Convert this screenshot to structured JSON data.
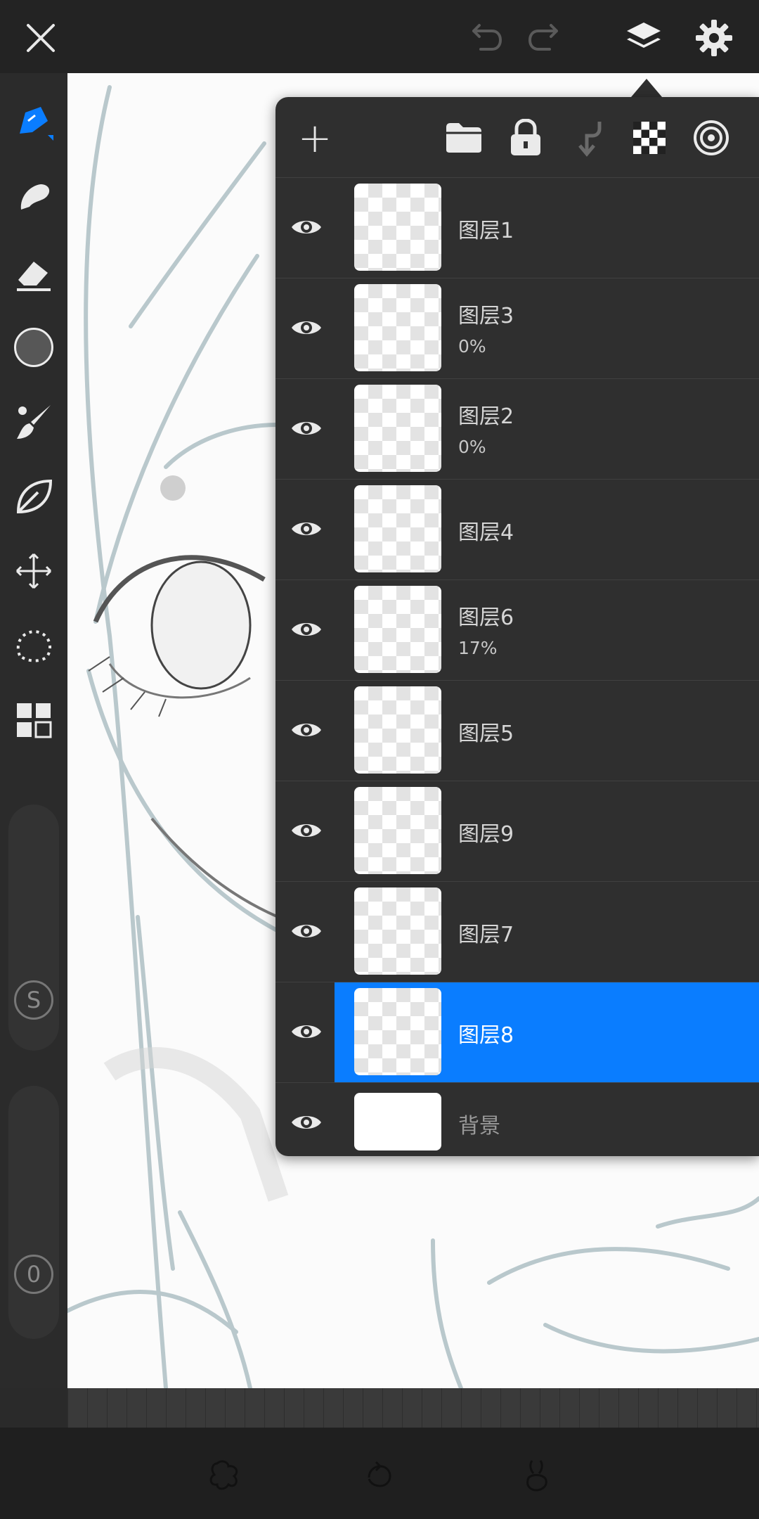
{
  "toolbar": {
    "close_icon": "close-icon",
    "undo_icon": "undo-icon",
    "redo_icon": "redo-icon",
    "layers_icon": "layers-icon",
    "settings_icon": "gear-icon"
  },
  "tools": {
    "slider_1_label": "S",
    "slider_2_label": "0",
    "items": [
      "pen-icon",
      "smudge-icon",
      "eraser-icon",
      "color-swatch",
      "brush-icon",
      "leaf-icon",
      "move-icon",
      "lasso-icon",
      "grid-icon"
    ]
  },
  "layers_panel": {
    "add_label": "+",
    "actions": [
      "folder-icon",
      "lock-icon",
      "merge-down-icon",
      "alpha-lock-icon",
      "target-icon"
    ],
    "layers": [
      {
        "name": "图层1",
        "opacity": ""
      },
      {
        "name": "图层3",
        "opacity": "0%"
      },
      {
        "name": "图层2",
        "opacity": "0%"
      },
      {
        "name": "图层4",
        "opacity": ""
      },
      {
        "name": "图层6",
        "opacity": "17%"
      },
      {
        "name": "图层5",
        "opacity": ""
      },
      {
        "name": "图层9",
        "opacity": ""
      },
      {
        "name": "图层7",
        "opacity": ""
      },
      {
        "name": "图层8",
        "opacity": "",
        "selected": true
      },
      {
        "name": "背景",
        "opacity": "",
        "background": true
      }
    ]
  },
  "colors": {
    "accent": "#0a7dff",
    "panel": "#2f2f2f",
    "topbar": "#232323"
  },
  "bottom": {
    "icons": [
      "puppet-icon",
      "loop-icon",
      "rabbit-icon"
    ]
  }
}
